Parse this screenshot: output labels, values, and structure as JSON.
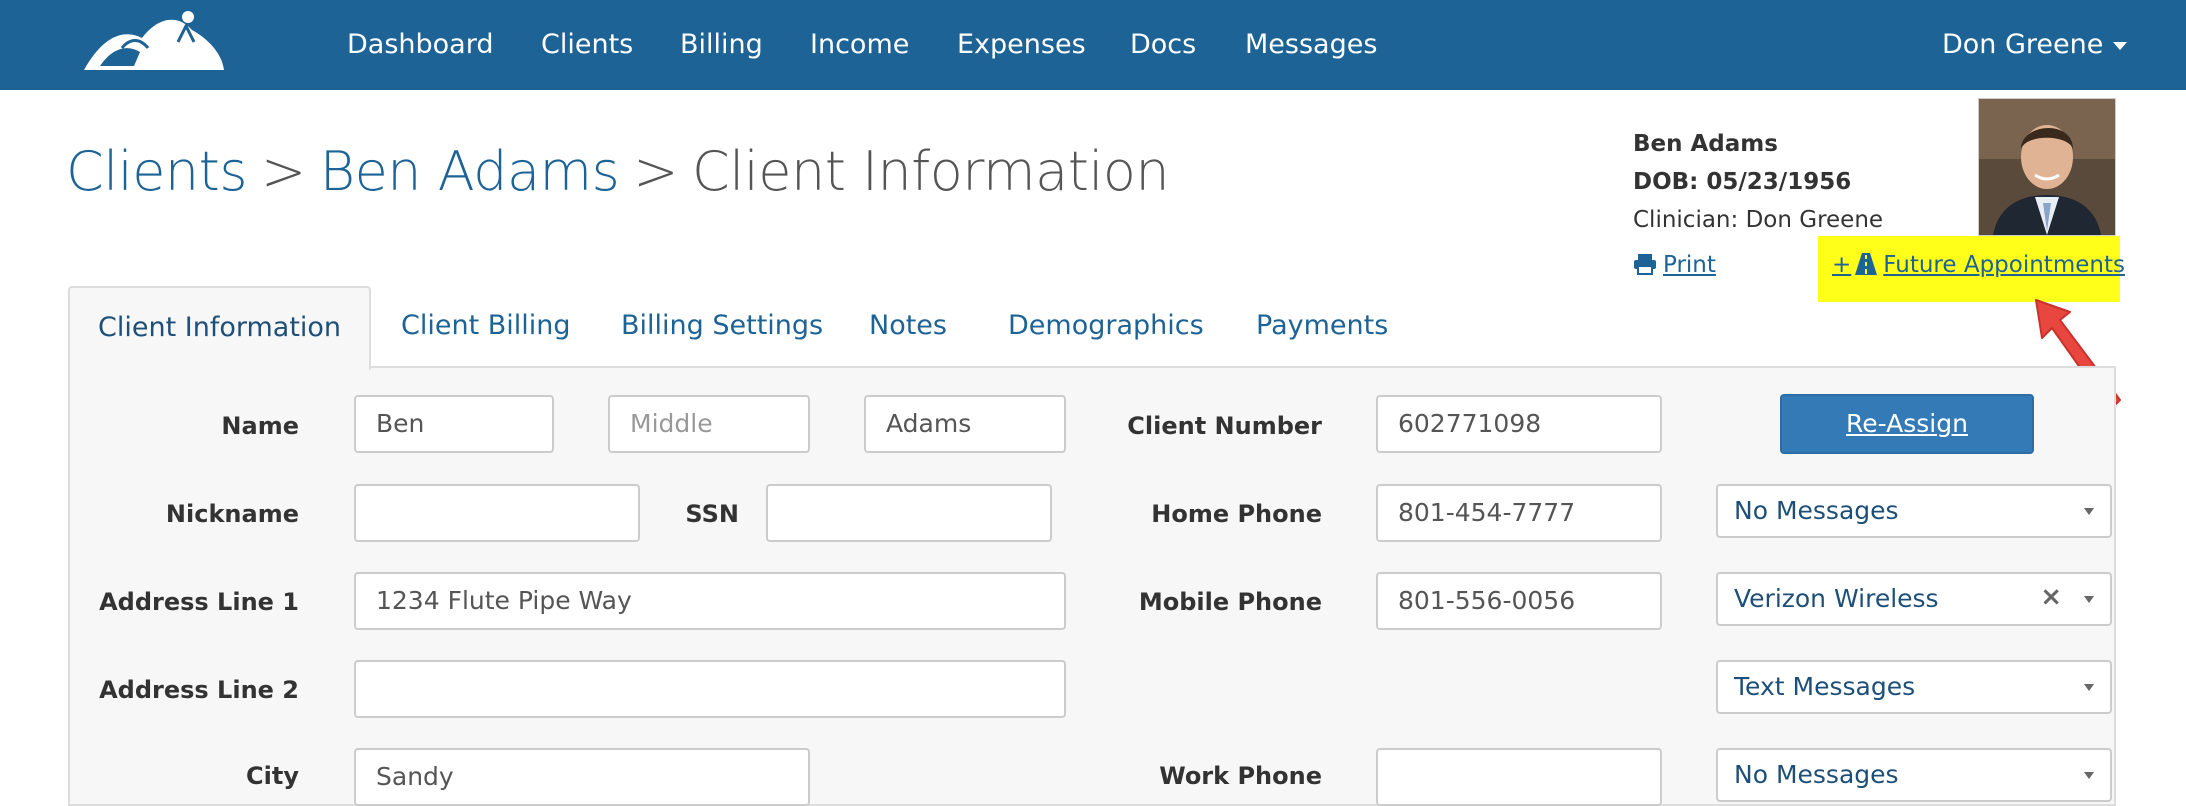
{
  "nav": {
    "links": [
      "Dashboard",
      "Clients",
      "Billing",
      "Income",
      "Expenses",
      "Docs",
      "Messages"
    ],
    "user": "Don Greene"
  },
  "breadcrumb": {
    "root": "Clients",
    "client": "Ben Adams",
    "current": "Client Information",
    "separator": ">"
  },
  "client_card": {
    "name": "Ben Adams",
    "dob": "DOB: 05/23/1956",
    "clinician": "Clinician: Don Greene",
    "print": "Print",
    "future_appointments": "Future Appointments",
    "future_prefix": "+"
  },
  "tabs": [
    "Client Information",
    "Client Billing",
    "Billing Settings",
    "Notes",
    "Demographics",
    "Payments"
  ],
  "form": {
    "labels": {
      "name": "Name",
      "nickname": "Nickname",
      "ssn": "SSN",
      "address1": "Address Line 1",
      "address2": "Address Line 2",
      "city": "City",
      "client_number": "Client Number",
      "home_phone": "Home Phone",
      "mobile_phone": "Mobile Phone",
      "work_phone": "Work Phone"
    },
    "values": {
      "first_name": "Ben",
      "middle_placeholder": "Middle",
      "last_name": "Adams",
      "nickname": "",
      "ssn": "",
      "address1": "1234 Flute Pipe Way",
      "address2": "",
      "city": "Sandy",
      "client_number": "602771098",
      "home_phone": "801-454-7777",
      "mobile_phone": "801-556-0056",
      "work_phone": ""
    },
    "selects": {
      "home_messages": "No Messages",
      "carrier": "Verizon Wireless",
      "mobile_messages": "Text Messages",
      "work_messages": "No Messages"
    },
    "reassign": "Re-Assign"
  },
  "colors": {
    "navbar": "#1e6396",
    "link": "#1e6396",
    "highlight": "#ffff1a",
    "primary_button": "#337ab7",
    "arrow": "#e8473f"
  }
}
